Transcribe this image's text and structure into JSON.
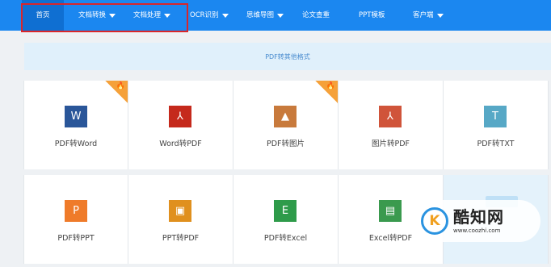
{
  "nav": {
    "items": [
      {
        "label": "首页",
        "dropdown": false,
        "active": true
      },
      {
        "label": "文档转换",
        "dropdown": true
      },
      {
        "label": "文档处理",
        "dropdown": true
      },
      {
        "label": "OCR识别",
        "dropdown": true
      },
      {
        "label": "思维导图",
        "dropdown": true
      },
      {
        "label": "论文查重",
        "dropdown": false
      },
      {
        "label": "PPT模板",
        "dropdown": false
      },
      {
        "label": "客户端",
        "dropdown": true
      }
    ]
  },
  "banner": {
    "text": "PDF转其他格式"
  },
  "tiles_row1": [
    {
      "label": "PDF转Word",
      "icon": "word-icon",
      "glyph": "W",
      "color": "#2a5699",
      "hot": true
    },
    {
      "label": "Word转PDF",
      "icon": "pdf-icon",
      "glyph": "⅄",
      "color": "#c5291c",
      "hot": false
    },
    {
      "label": "PDF转图片",
      "icon": "image-icon",
      "glyph": "▲",
      "color": "#c87a3c",
      "hot": true
    },
    {
      "label": "图片转PDF",
      "icon": "pdf-icon",
      "glyph": "⅄",
      "color": "#d0543a",
      "hot": false
    },
    {
      "label": "PDF转TXT",
      "icon": "txt-icon",
      "glyph": "T",
      "color": "#57a8c6",
      "hot": false
    }
  ],
  "tiles_row2": [
    {
      "label": "PDF转PPT",
      "icon": "ppt-icon",
      "glyph": "P",
      "color": "#ef7b2a"
    },
    {
      "label": "PPT转PDF",
      "icon": "ppt-pdf-icon",
      "glyph": "▣",
      "color": "#e0901e"
    },
    {
      "label": "PDF转Excel",
      "icon": "excel-icon",
      "glyph": "E",
      "color": "#2e9b4a"
    },
    {
      "label": "Excel转PDF",
      "icon": "excel-pdf-icon",
      "glyph": "▤",
      "color": "#3a9a4e"
    }
  ],
  "hot_glyph": "🔥",
  "watermark": {
    "name": "酷知网",
    "url": "www.coozhi.com",
    "logo_glyph": "K"
  },
  "colors": {
    "nav_bg": "#1b87f0",
    "nav_active": "#0f6fd2",
    "highlight_border": "#d9252a",
    "hot_badge": "#f5a13a"
  }
}
